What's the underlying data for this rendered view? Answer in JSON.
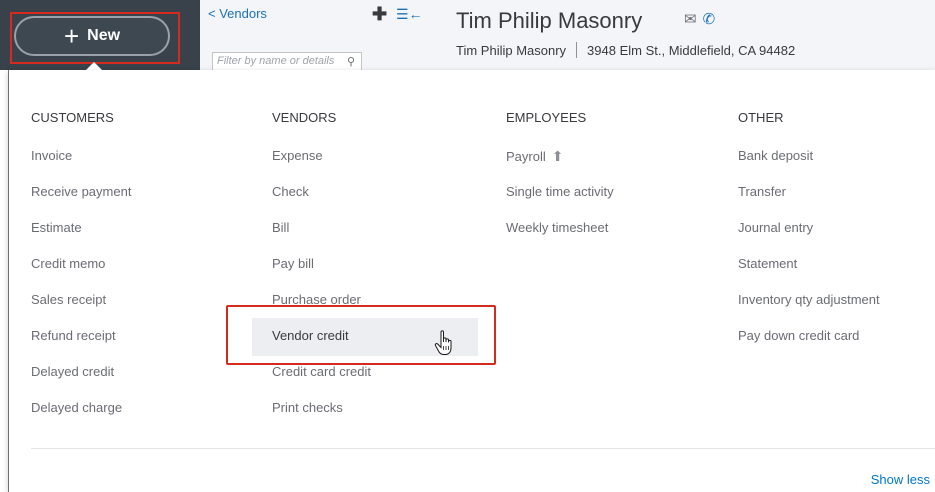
{
  "header": {
    "new_button": "New",
    "back_link": "< Vendors",
    "filter_placeholder": "Filter by name or details",
    "vendor_title": "Tim Philip Masonry",
    "vendor_subname": "Tim Philip Masonry",
    "vendor_address": "3948 Elm St., Middlefield, CA 94482"
  },
  "menu": {
    "customers": {
      "heading": "CUSTOMERS",
      "items": [
        "Invoice",
        "Receive payment",
        "Estimate",
        "Credit memo",
        "Sales receipt",
        "Refund receipt",
        "Delayed credit",
        "Delayed charge"
      ]
    },
    "vendors": {
      "heading": "VENDORS",
      "items": [
        "Expense",
        "Check",
        "Bill",
        "Pay bill",
        "Purchase order",
        "Vendor credit",
        "Credit card credit",
        "Print checks"
      ]
    },
    "employees": {
      "heading": "EMPLOYEES",
      "items": [
        "Payroll",
        "Single time activity",
        "Weekly timesheet"
      ]
    },
    "other": {
      "heading": "OTHER",
      "items": [
        "Bank deposit",
        "Transfer",
        "Journal entry",
        "Statement",
        "Inventory qty adjustment",
        "Pay down credit card"
      ]
    },
    "show_less": "Show less"
  },
  "icons": {
    "new": "plus-icon",
    "add": "plus-icon",
    "collapse": "collapse-icon",
    "search": "search-icon",
    "mail": "mail-icon",
    "phone": "phone-icon",
    "upgrade": "upgrade-arrow-icon",
    "cursor": "hand-cursor-icon"
  },
  "colors": {
    "accent": "#0077c5",
    "highlight": "#d52b1e",
    "header_bg": "#39424b"
  }
}
